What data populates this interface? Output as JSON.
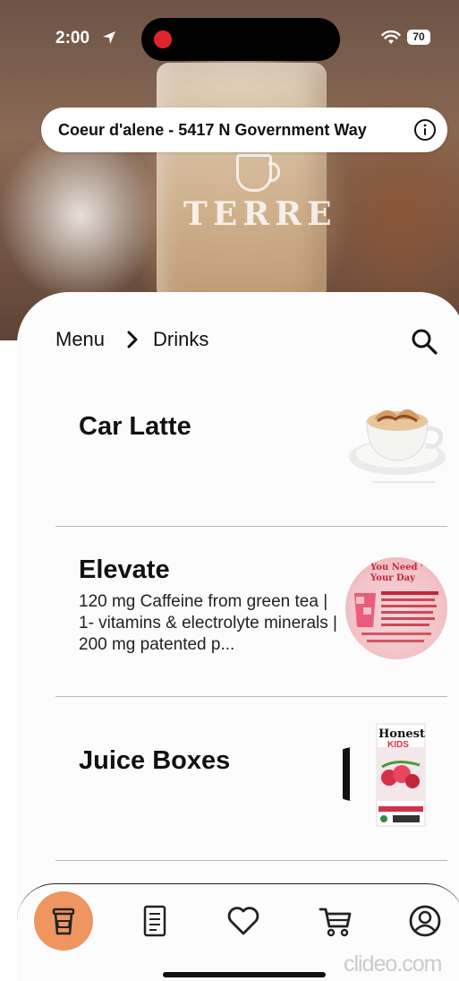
{
  "status_bar": {
    "time": "2:00",
    "battery": "70"
  },
  "hero": {
    "cup_brand": "TERRE"
  },
  "location": {
    "label": "Coeur d'alene - 5417 N Government Way"
  },
  "breadcrumb": {
    "root": "Menu",
    "current": "Drinks"
  },
  "items": [
    {
      "title": "Car Latte",
      "description": ""
    },
    {
      "title": "Elevate",
      "description": "120 mg Caffeine from green tea | 1- vitamins & electrolyte minerals | 200 mg patented p..."
    },
    {
      "title": "Juice Boxes",
      "description": ""
    }
  ],
  "product_images": {
    "elevate_headline": "You Need ‘ Your Day",
    "juice_brand": "Honest",
    "juice_sub": "KIDS"
  },
  "tabbar": {
    "tabs": [
      "drinks-cup-icon",
      "menu-document-icon",
      "favorites-heart-icon",
      "cart-icon",
      "profile-icon"
    ],
    "active_color": "#ee9560"
  },
  "watermark": "clideo.com"
}
